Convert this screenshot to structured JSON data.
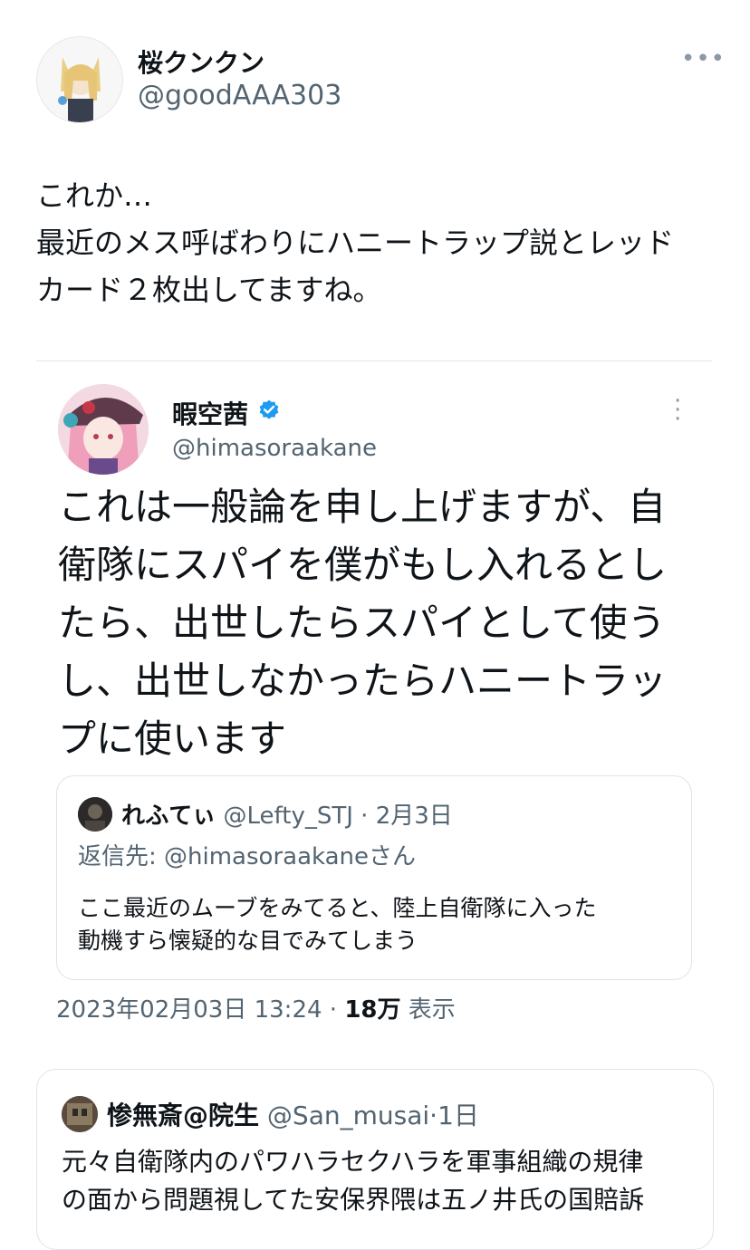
{
  "main": {
    "display_name": "桜クンクン",
    "handle": "@goodAAA303",
    "more_icon": "more-horizontal-icon",
    "text_lines": [
      "これか…",
      "最近のメス呼ばわりにハニートラップ説とレッド",
      "カード２枚出してますね。"
    ]
  },
  "quoted": {
    "display_name": "暇空茜",
    "handle": "@himasoraakane",
    "verified_icon": "verified-badge-icon",
    "more_icon": "more-vertical-icon",
    "text_lines": [
      "これは一般論を申し上げますが、自",
      "衛隊にスパイを僕がもし入れるとし",
      "たら、出世したらスパイとして使う",
      "し、出世しなかったらハニートラッ",
      "プに使います"
    ],
    "reply": {
      "display_name": "れふてぃ",
      "handle": "@Lefty_STJ",
      "date": "2月3日",
      "reply_to_label": "返信先:",
      "reply_to_handle": "@himasoraakane",
      "reply_to_suffix": "さん",
      "text_lines": [
        "ここ最近のムーブをみてると、陸上自衛隊に入った",
        "動機すら懐疑的な目でみてしまう"
      ]
    },
    "meta": {
      "timestamp": "2023年02月03日 13:24",
      "views_count": "18万",
      "views_label": "表示"
    }
  },
  "card2": {
    "display_name": "惨無斎@院生",
    "handle": "@San_musai",
    "date": "1日",
    "text_lines": [
      "元々自衛隊内のパワハラセクハラを軍事組織の規律",
      "の面から問題視してた安保界隈は五ノ井氏の国賠訴"
    ]
  },
  "colors": {
    "text": "#0f1419",
    "muted": "#536471",
    "border": "#dfe3e7",
    "verified": "#1d9bf0"
  }
}
